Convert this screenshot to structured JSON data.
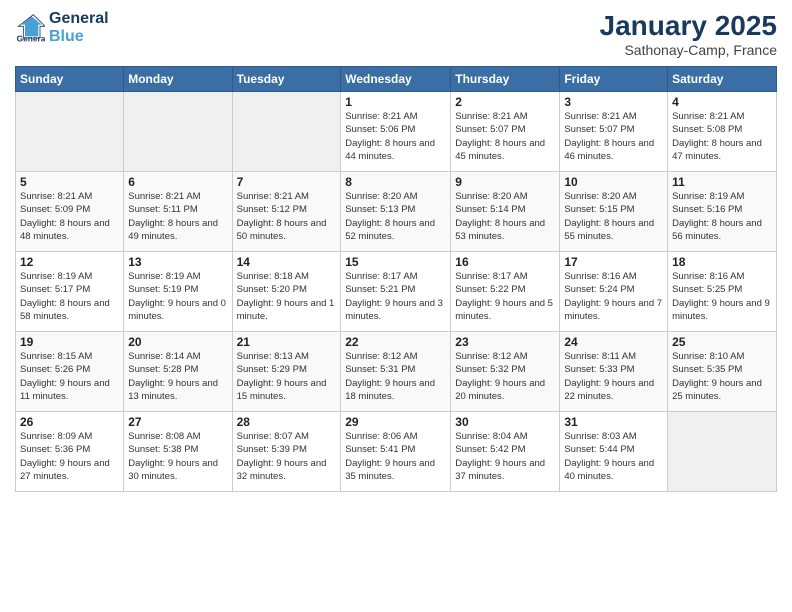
{
  "header": {
    "logo_line1": "General",
    "logo_line2": "Blue",
    "main_title": "January 2025",
    "subtitle": "Sathonay-Camp, France"
  },
  "weekdays": [
    "Sunday",
    "Monday",
    "Tuesday",
    "Wednesday",
    "Thursday",
    "Friday",
    "Saturday"
  ],
  "weeks": [
    [
      {
        "day": "",
        "sunrise": "",
        "sunset": "",
        "daylight": ""
      },
      {
        "day": "",
        "sunrise": "",
        "sunset": "",
        "daylight": ""
      },
      {
        "day": "",
        "sunrise": "",
        "sunset": "",
        "daylight": ""
      },
      {
        "day": "1",
        "sunrise": "Sunrise: 8:21 AM",
        "sunset": "Sunset: 5:06 PM",
        "daylight": "Daylight: 8 hours and 44 minutes."
      },
      {
        "day": "2",
        "sunrise": "Sunrise: 8:21 AM",
        "sunset": "Sunset: 5:07 PM",
        "daylight": "Daylight: 8 hours and 45 minutes."
      },
      {
        "day": "3",
        "sunrise": "Sunrise: 8:21 AM",
        "sunset": "Sunset: 5:07 PM",
        "daylight": "Daylight: 8 hours and 46 minutes."
      },
      {
        "day": "4",
        "sunrise": "Sunrise: 8:21 AM",
        "sunset": "Sunset: 5:08 PM",
        "daylight": "Daylight: 8 hours and 47 minutes."
      }
    ],
    [
      {
        "day": "5",
        "sunrise": "Sunrise: 8:21 AM",
        "sunset": "Sunset: 5:09 PM",
        "daylight": "Daylight: 8 hours and 48 minutes."
      },
      {
        "day": "6",
        "sunrise": "Sunrise: 8:21 AM",
        "sunset": "Sunset: 5:11 PM",
        "daylight": "Daylight: 8 hours and 49 minutes."
      },
      {
        "day": "7",
        "sunrise": "Sunrise: 8:21 AM",
        "sunset": "Sunset: 5:12 PM",
        "daylight": "Daylight: 8 hours and 50 minutes."
      },
      {
        "day": "8",
        "sunrise": "Sunrise: 8:20 AM",
        "sunset": "Sunset: 5:13 PM",
        "daylight": "Daylight: 8 hours and 52 minutes."
      },
      {
        "day": "9",
        "sunrise": "Sunrise: 8:20 AM",
        "sunset": "Sunset: 5:14 PM",
        "daylight": "Daylight: 8 hours and 53 minutes."
      },
      {
        "day": "10",
        "sunrise": "Sunrise: 8:20 AM",
        "sunset": "Sunset: 5:15 PM",
        "daylight": "Daylight: 8 hours and 55 minutes."
      },
      {
        "day": "11",
        "sunrise": "Sunrise: 8:19 AM",
        "sunset": "Sunset: 5:16 PM",
        "daylight": "Daylight: 8 hours and 56 minutes."
      }
    ],
    [
      {
        "day": "12",
        "sunrise": "Sunrise: 8:19 AM",
        "sunset": "Sunset: 5:17 PM",
        "daylight": "Daylight: 8 hours and 58 minutes."
      },
      {
        "day": "13",
        "sunrise": "Sunrise: 8:19 AM",
        "sunset": "Sunset: 5:19 PM",
        "daylight": "Daylight: 9 hours and 0 minutes."
      },
      {
        "day": "14",
        "sunrise": "Sunrise: 8:18 AM",
        "sunset": "Sunset: 5:20 PM",
        "daylight": "Daylight: 9 hours and 1 minute."
      },
      {
        "day": "15",
        "sunrise": "Sunrise: 8:17 AM",
        "sunset": "Sunset: 5:21 PM",
        "daylight": "Daylight: 9 hours and 3 minutes."
      },
      {
        "day": "16",
        "sunrise": "Sunrise: 8:17 AM",
        "sunset": "Sunset: 5:22 PM",
        "daylight": "Daylight: 9 hours and 5 minutes."
      },
      {
        "day": "17",
        "sunrise": "Sunrise: 8:16 AM",
        "sunset": "Sunset: 5:24 PM",
        "daylight": "Daylight: 9 hours and 7 minutes."
      },
      {
        "day": "18",
        "sunrise": "Sunrise: 8:16 AM",
        "sunset": "Sunset: 5:25 PM",
        "daylight": "Daylight: 9 hours and 9 minutes."
      }
    ],
    [
      {
        "day": "19",
        "sunrise": "Sunrise: 8:15 AM",
        "sunset": "Sunset: 5:26 PM",
        "daylight": "Daylight: 9 hours and 11 minutes."
      },
      {
        "day": "20",
        "sunrise": "Sunrise: 8:14 AM",
        "sunset": "Sunset: 5:28 PM",
        "daylight": "Daylight: 9 hours and 13 minutes."
      },
      {
        "day": "21",
        "sunrise": "Sunrise: 8:13 AM",
        "sunset": "Sunset: 5:29 PM",
        "daylight": "Daylight: 9 hours and 15 minutes."
      },
      {
        "day": "22",
        "sunrise": "Sunrise: 8:12 AM",
        "sunset": "Sunset: 5:31 PM",
        "daylight": "Daylight: 9 hours and 18 minutes."
      },
      {
        "day": "23",
        "sunrise": "Sunrise: 8:12 AM",
        "sunset": "Sunset: 5:32 PM",
        "daylight": "Daylight: 9 hours and 20 minutes."
      },
      {
        "day": "24",
        "sunrise": "Sunrise: 8:11 AM",
        "sunset": "Sunset: 5:33 PM",
        "daylight": "Daylight: 9 hours and 22 minutes."
      },
      {
        "day": "25",
        "sunrise": "Sunrise: 8:10 AM",
        "sunset": "Sunset: 5:35 PM",
        "daylight": "Daylight: 9 hours and 25 minutes."
      }
    ],
    [
      {
        "day": "26",
        "sunrise": "Sunrise: 8:09 AM",
        "sunset": "Sunset: 5:36 PM",
        "daylight": "Daylight: 9 hours and 27 minutes."
      },
      {
        "day": "27",
        "sunrise": "Sunrise: 8:08 AM",
        "sunset": "Sunset: 5:38 PM",
        "daylight": "Daylight: 9 hours and 30 minutes."
      },
      {
        "day": "28",
        "sunrise": "Sunrise: 8:07 AM",
        "sunset": "Sunset: 5:39 PM",
        "daylight": "Daylight: 9 hours and 32 minutes."
      },
      {
        "day": "29",
        "sunrise": "Sunrise: 8:06 AM",
        "sunset": "Sunset: 5:41 PM",
        "daylight": "Daylight: 9 hours and 35 minutes."
      },
      {
        "day": "30",
        "sunrise": "Sunrise: 8:04 AM",
        "sunset": "Sunset: 5:42 PM",
        "daylight": "Daylight: 9 hours and 37 minutes."
      },
      {
        "day": "31",
        "sunrise": "Sunrise: 8:03 AM",
        "sunset": "Sunset: 5:44 PM",
        "daylight": "Daylight: 9 hours and 40 minutes."
      },
      {
        "day": "",
        "sunrise": "",
        "sunset": "",
        "daylight": ""
      }
    ]
  ]
}
